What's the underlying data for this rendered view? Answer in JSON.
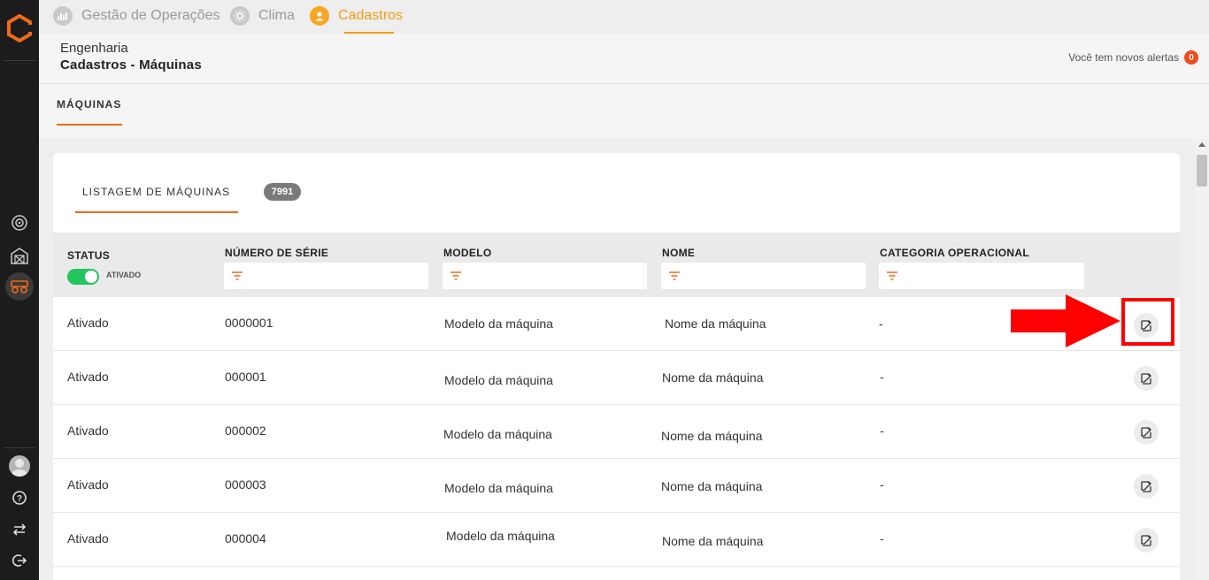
{
  "nav": {
    "tabs": [
      {
        "label": "Gestão de Operações",
        "icon": "chart-hand-icon",
        "active": false
      },
      {
        "label": "Clima",
        "icon": "sun-icon",
        "active": false
      },
      {
        "label": "Cadastros",
        "icon": "user-icon",
        "active": true
      }
    ]
  },
  "header": {
    "subtitle": "Engenharia",
    "title": "Cadastros - Máquinas",
    "alerts_label": "Você tem novos alertas",
    "alerts_count": "0"
  },
  "section": {
    "tab_label": "MÁQUINAS"
  },
  "listing": {
    "tab_label": "LISTAGEM DE MÁQUINAS",
    "count": "7991",
    "columns": {
      "status": "STATUS",
      "serial": "NÚMERO DE SÉRIE",
      "model": "MODELO",
      "name": "NOME",
      "category": "CATEGORIA OPERACIONAL"
    },
    "status_toggle_label": "ATIVADO",
    "rows": [
      {
        "status": "Ativado",
        "serial": "0000001",
        "model": "Modelo da máquina",
        "name": "Nome da máquina",
        "category": "-"
      },
      {
        "status": "Ativado",
        "serial": "000001",
        "model": "Modelo da máquina",
        "name": "Nome da máquina",
        "category": "-"
      },
      {
        "status": "Ativado",
        "serial": "000002",
        "model": "Modelo da máquina",
        "name": "Nome da máquina",
        "category": "-"
      },
      {
        "status": "Ativado",
        "serial": "000003",
        "model": "Modelo da máquina",
        "name": "Nome da máquina",
        "category": "-"
      },
      {
        "status": "Ativado",
        "serial": "000004",
        "model": "Modelo da máquina",
        "name": "Nome da máquina",
        "category": "-"
      }
    ]
  },
  "colors": {
    "accent": "#f06a1a",
    "active_tab": "#f39c12",
    "toggle_on": "#22c55e",
    "highlight": "#ff0000"
  }
}
